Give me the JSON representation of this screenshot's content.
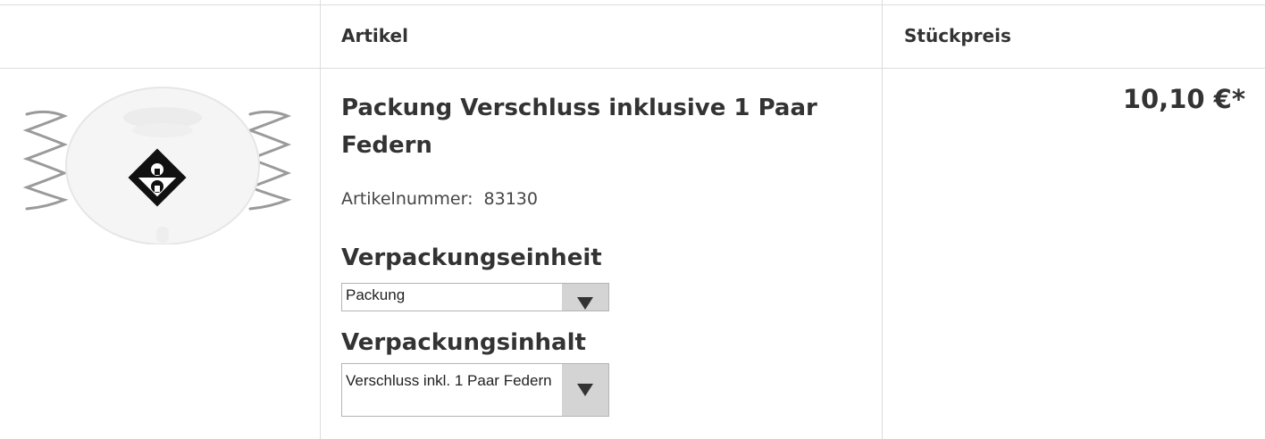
{
  "table": {
    "headers": {
      "article": "Artikel",
      "unit_price": "Stückpreis"
    }
  },
  "product": {
    "title": "Packung Verschluss inklusive 1 Paar Federn",
    "article_number_label": "Artikelnummer:",
    "article_number": "83130",
    "price": "10,10 €*",
    "image": "clasp-with-springs-icon"
  },
  "options": {
    "packaging_unit": {
      "label": "Verpackungseinheit",
      "selected": "Packung"
    },
    "packaging_content": {
      "label": "Verpackungsinhalt",
      "selected": "Verschluss inkl. 1 Paar Federn"
    }
  }
}
